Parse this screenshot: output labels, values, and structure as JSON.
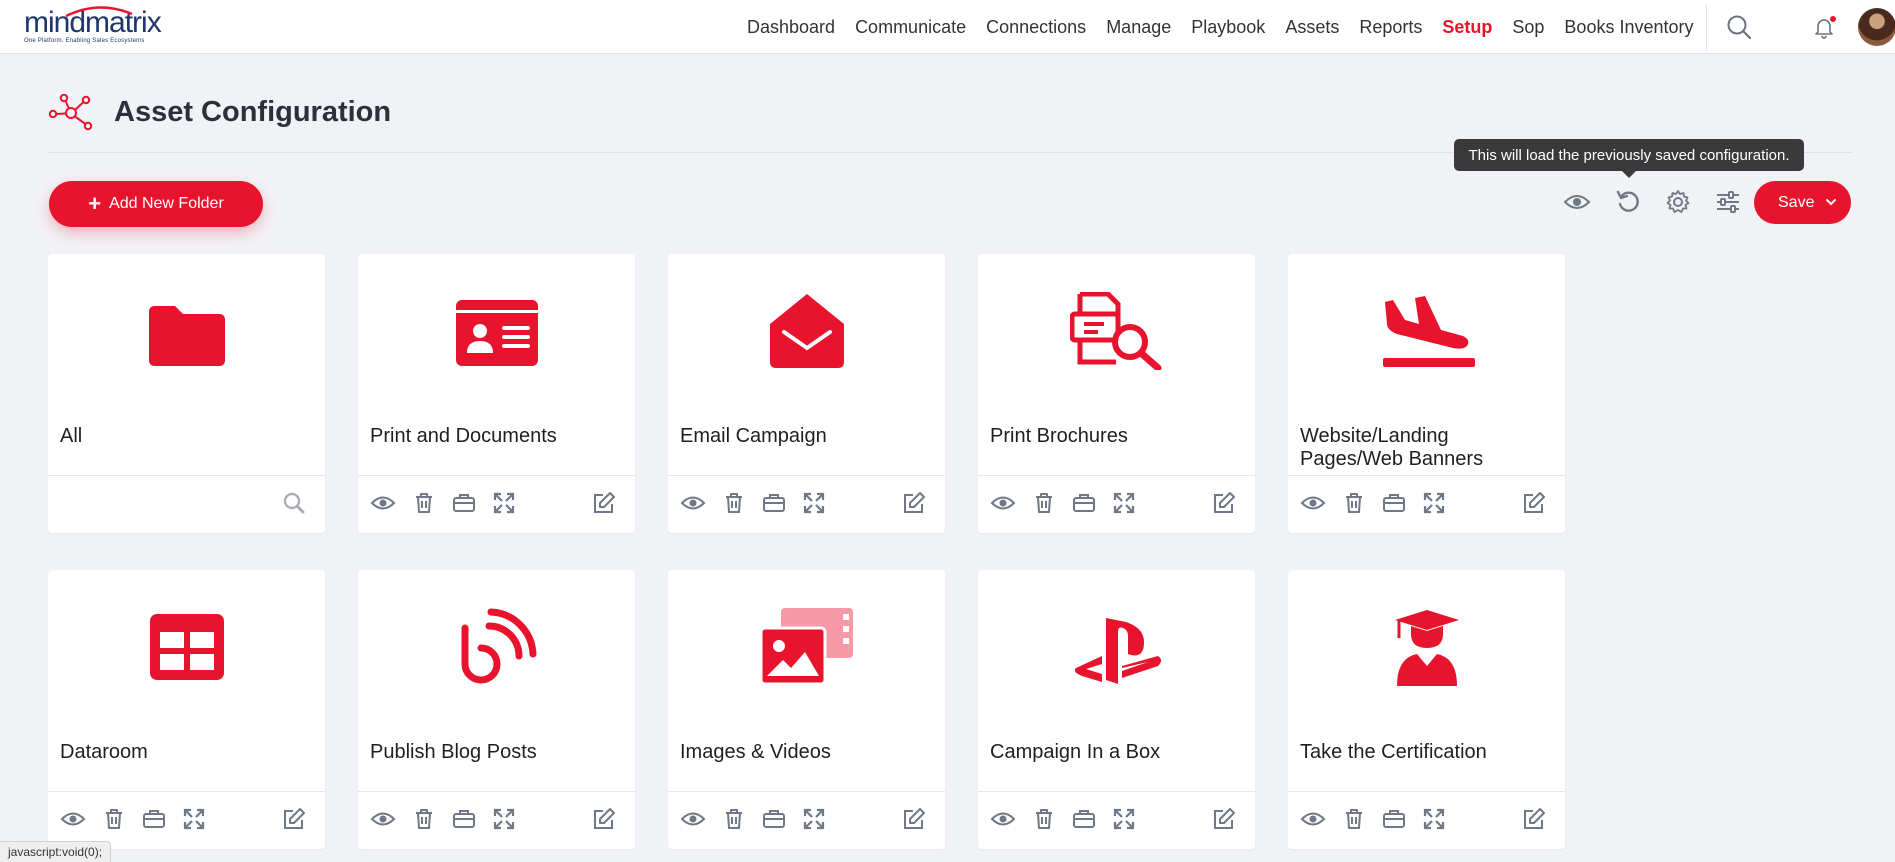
{
  "brand": {
    "name": "mindmatrix",
    "tagline": "One Platform. Enabling Sales Ecosystems",
    "accent": "#e8142d"
  },
  "nav": {
    "items": [
      "Dashboard",
      "Communicate",
      "Connections",
      "Manage",
      "Playbook",
      "Assets",
      "Reports",
      "Setup",
      "Sop",
      "Books Inventory"
    ],
    "active": "Setup"
  },
  "page": {
    "title": "Asset Configuration"
  },
  "toolbar": {
    "add_folder_label": "Add New Folder",
    "save_label": "Save",
    "tooltip": "This will load the previously saved configuration."
  },
  "cards": [
    {
      "title": "All",
      "icon": "folder-icon"
    },
    {
      "title": "Print and Documents",
      "icon": "id-card-icon"
    },
    {
      "title": "Email Campaign",
      "icon": "envelope-open-icon"
    },
    {
      "title": "Print Brochures",
      "icon": "file-search-icon"
    },
    {
      "title": "Website/Landing Pages/Web Banners",
      "icon": "plane-landing-icon"
    },
    {
      "title": "Dataroom",
      "icon": "table-icon"
    },
    {
      "title": "Publish Blog Posts",
      "icon": "blog-icon"
    },
    {
      "title": "Images & Videos",
      "icon": "photo-video-icon"
    },
    {
      "title": "Campaign In a Box",
      "icon": "playstation-icon"
    },
    {
      "title": "Take the Certification",
      "icon": "graduate-icon"
    }
  ],
  "statusbar": "javascript:void(0);"
}
